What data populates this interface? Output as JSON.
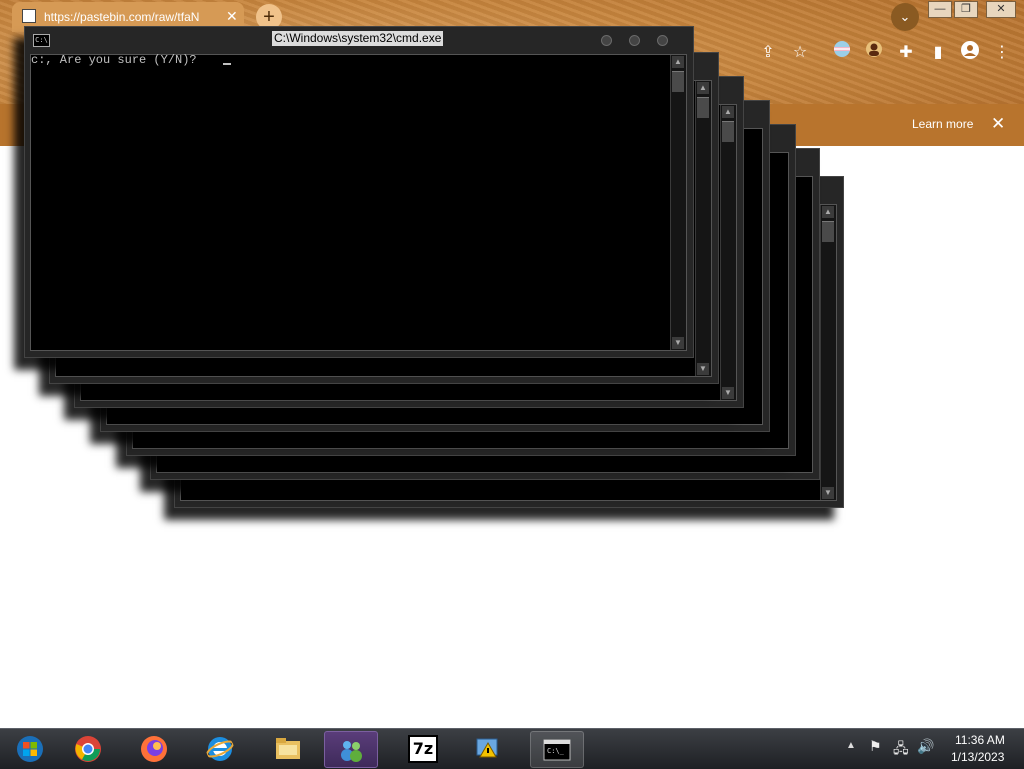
{
  "browser": {
    "tab_title": "https://pastebin.com/raw/tfaN",
    "tab_close": "✕",
    "new_tab": "+",
    "tab_search": "⌄",
    "window_controls": [
      "—",
      "❐",
      "✕"
    ],
    "toolbar_icons": [
      "share-icon",
      "star-icon",
      "extension-flag-icon",
      "profile-avatar-icon",
      "puzzle-icon",
      "sidepanel-icon",
      "account-icon",
      "menu-icon"
    ],
    "banner": {
      "link_label": "Learn more",
      "close": "✕"
    }
  },
  "cmd": {
    "title": "C:\\Windows\\system32\\cmd.exe",
    "sys_icon": "C:\\",
    "prompt_text": "c:, Are you sure (Y/N)? "
  },
  "taskbar": {
    "items": [
      "start-orb",
      "chrome",
      "firefox",
      "internet-explorer",
      "file-explorer",
      "windows-live-messenger",
      "7zip",
      "action-center-app",
      "command-prompt"
    ],
    "seven_zip_label": "7z",
    "time": "11:36 AM",
    "date": "1/13/2023"
  },
  "colors": {
    "taskbar": "#2a2c30",
    "console_bg": "#000000",
    "console_text": "#c0c0c0",
    "banner": "#b8742d"
  }
}
